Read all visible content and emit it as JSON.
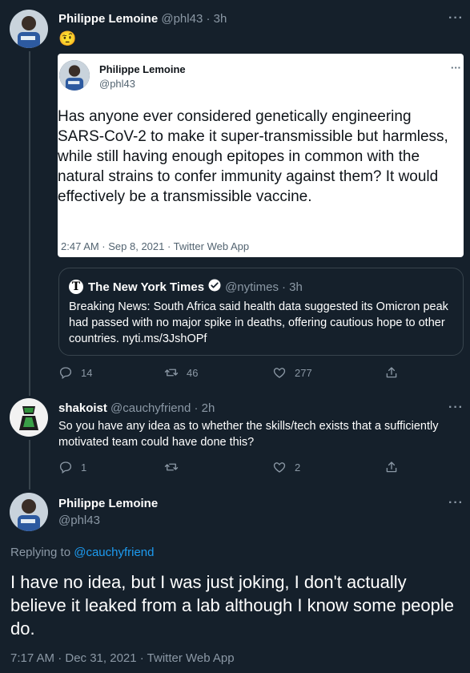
{
  "tweet1": {
    "name": "Philippe Lemoine",
    "handle": "@phl43",
    "time": "· 3h",
    "emoji": "🤨",
    "screenshot": {
      "name": "Philippe Lemoine",
      "handle": "@phl43",
      "body": "Has anyone ever considered genetically engineering SARS-CoV-2 to make it super-transmissible but harmless, while still having enough epitopes in common with the natural strains to confer immunity against them? It would effectively be a transmissible vaccine.",
      "meta": "2:47 AM · Sep 8, 2021 · Twitter Web App"
    },
    "quote": {
      "name": "The New York Times",
      "handle": "@nytimes",
      "time": "· 3h",
      "body": "Breaking News: South Africa said health data suggested its Omicron peak had passed with no major spike in deaths, offering cautious hope to other countries. nyti.ms/3JshOPf"
    },
    "actions": {
      "replies": "14",
      "retweets": "46",
      "likes": "277"
    }
  },
  "tweet2": {
    "name": "shakoist",
    "handle": "@cauchyfriend",
    "time": "· 2h",
    "body": "So you have any idea as to whether the skills/tech exists that a sufficiently motivated team could have done this?",
    "actions": {
      "replies": "1",
      "retweets": "",
      "likes": "2"
    }
  },
  "tweet3": {
    "name": "Philippe Lemoine",
    "handle": "@phl43",
    "replying_prefix": "Replying to",
    "replying_to": "@cauchyfriend",
    "body": "I have no idea, but I was just joking, I don't actually believe it leaked from a lab although I know some people do.",
    "meta": "7:17 AM · Dec 31, 2021 · Twitter Web App"
  },
  "more_glyph": "···",
  "colors": {
    "background": "#15202b",
    "accent": "#1d9bf0",
    "muted": "#8b98a5",
    "border": "#38444d"
  },
  "icons": [
    "reply-icon",
    "retweet-icon",
    "like-icon",
    "share-icon",
    "verified-icon",
    "nyt-logo-icon",
    "more-icon"
  ]
}
